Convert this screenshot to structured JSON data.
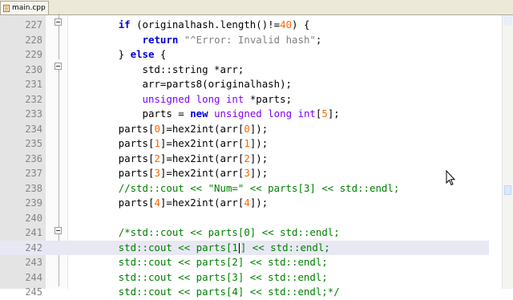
{
  "tab": {
    "label": "main.cpp",
    "icon": "file-icon"
  },
  "lines": [
    {
      "num": "227",
      "tokens": [
        [
          "",
          "        "
        ],
        [
          "kw",
          "if"
        ],
        [
          "",
          " (originalhash.length()!="
        ],
        [
          "num",
          "40"
        ],
        [
          "",
          ") {"
        ]
      ]
    },
    {
      "num": "228",
      "tokens": [
        [
          "",
          "            "
        ],
        [
          "kw",
          "return"
        ],
        [
          "",
          " "
        ],
        [
          "str",
          "\"^Error: Invalid hash\""
        ],
        [
          "",
          ";"
        ]
      ]
    },
    {
      "num": "229",
      "tokens": [
        [
          "",
          "        } "
        ],
        [
          "kw",
          "else"
        ],
        [
          "",
          " {"
        ]
      ]
    },
    {
      "num": "230",
      "tokens": [
        [
          "",
          "            std::string *arr;"
        ]
      ]
    },
    {
      "num": "231",
      "tokens": [
        [
          "",
          "            arr=parts8(originalhash);"
        ]
      ]
    },
    {
      "num": "232",
      "tokens": [
        [
          "",
          "            "
        ],
        [
          "ty",
          "unsigned long int"
        ],
        [
          "",
          " *parts;"
        ]
      ]
    },
    {
      "num": "233",
      "tokens": [
        [
          "",
          "            parts = "
        ],
        [
          "kw",
          "new"
        ],
        [
          "",
          " "
        ],
        [
          "ty",
          "unsigned long int"
        ],
        [
          "",
          "["
        ],
        [
          "num",
          "5"
        ],
        [
          "",
          "];"
        ]
      ]
    },
    {
      "num": "234",
      "tokens": [
        [
          "",
          "        parts["
        ],
        [
          "num",
          "0"
        ],
        [
          "",
          "]=hex2int(arr["
        ],
        [
          "num",
          "0"
        ],
        [
          "",
          "]);"
        ]
      ]
    },
    {
      "num": "235",
      "tokens": [
        [
          "",
          "        parts["
        ],
        [
          "num",
          "1"
        ],
        [
          "",
          "]=hex2int(arr["
        ],
        [
          "num",
          "1"
        ],
        [
          "",
          "]);"
        ]
      ]
    },
    {
      "num": "236",
      "tokens": [
        [
          "",
          "        parts["
        ],
        [
          "num",
          "2"
        ],
        [
          "",
          "]=hex2int(arr["
        ],
        [
          "num",
          "2"
        ],
        [
          "",
          "]);"
        ]
      ]
    },
    {
      "num": "237",
      "tokens": [
        [
          "",
          "        parts["
        ],
        [
          "num",
          "3"
        ],
        [
          "",
          "]=hex2int(arr["
        ],
        [
          "num",
          "3"
        ],
        [
          "",
          "]);"
        ]
      ]
    },
    {
      "num": "238",
      "tokens": [
        [
          "",
          "        "
        ],
        [
          "cm",
          "//std::cout << \"Num=\" << parts[3] << std::endl;"
        ]
      ]
    },
    {
      "num": "239",
      "tokens": [
        [
          "",
          "        parts["
        ],
        [
          "num",
          "4"
        ],
        [
          "",
          "]=hex2int(arr["
        ],
        [
          "num",
          "4"
        ],
        [
          "",
          "]);"
        ]
      ]
    },
    {
      "num": "240",
      "tokens": []
    },
    {
      "num": "241",
      "tokens": [
        [
          "",
          "        "
        ],
        [
          "cm",
          "/*std::cout << parts[0] << std::endl;"
        ]
      ]
    },
    {
      "num": "242",
      "current": true,
      "tokens": [
        [
          "cm",
          "        std::cout << parts[1"
        ],
        [
          "caret",
          ""
        ],
        [
          "cm",
          "] << std::endl;"
        ]
      ]
    },
    {
      "num": "243",
      "tokens": [
        [
          "cm",
          "        std::cout << parts[2] << std::endl;"
        ]
      ]
    },
    {
      "num": "244",
      "tokens": [
        [
          "cm",
          "        std::cout << parts[3] << std::endl;"
        ]
      ]
    },
    {
      "num": "245",
      "tokens": [
        [
          "cm",
          "        std::cout << parts[4] << std::endl;*/"
        ]
      ]
    }
  ]
}
